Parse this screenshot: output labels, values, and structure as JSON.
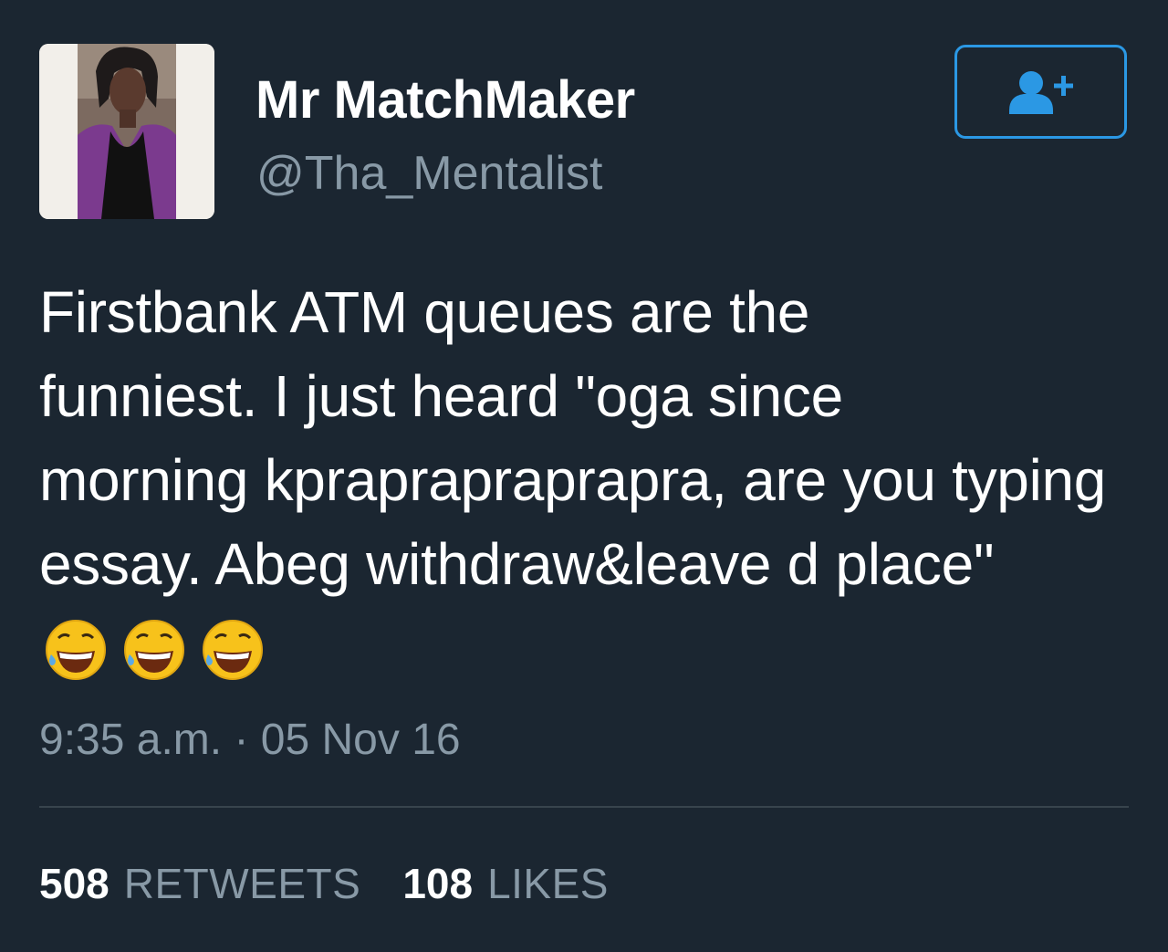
{
  "user": {
    "display_name": "Mr MatchMaker",
    "handle": "@Tha_Mentalist"
  },
  "follow_button": {
    "icon": "add-user-icon",
    "accent_color": "#2b98e4"
  },
  "tweet": {
    "lines": [
      "Firstbank ATM queues are the",
      "funniest. I just heard \"oga since",
      "morning kpraprapraprapra, are you typing",
      "essay. Abeg withdraw&leave d place\""
    ],
    "emojis": [
      "grinning-sweat-emoji",
      "grinning-sweat-emoji",
      "grinning-sweat-emoji"
    ],
    "timestamp": "9:35 a.m. · 05 Nov 16"
  },
  "stats": {
    "retweets_count": "508",
    "retweets_label": "RETWEETS",
    "likes_count": "108",
    "likes_label": "LIKES"
  },
  "colors": {
    "background": "#1b2631",
    "secondary_text": "#8899a6",
    "divider": "#38444d"
  }
}
